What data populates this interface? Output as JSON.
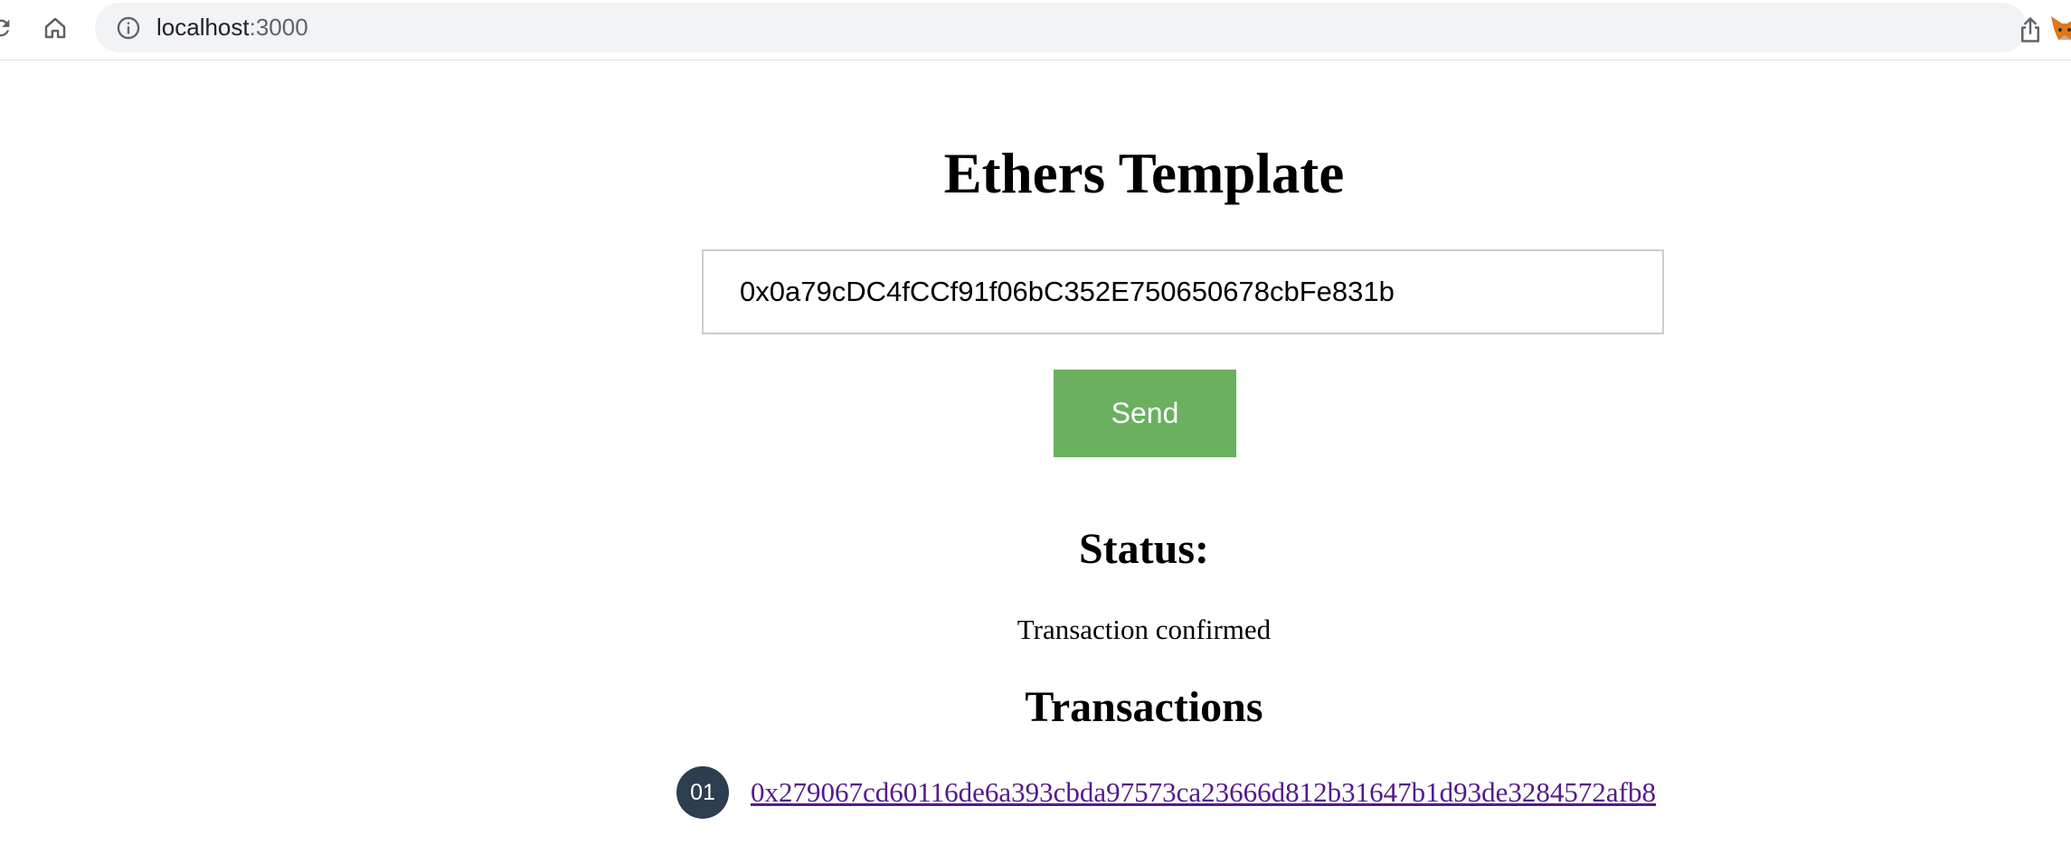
{
  "browser": {
    "url_host": "localhost",
    "url_port": ":3000",
    "icons": [
      "reload-icon",
      "home-icon",
      "info-icon",
      "share-icon",
      "star-icon",
      "extension-fox-icon"
    ]
  },
  "page": {
    "title": "Ethers Template",
    "address_input_value": "0x0a79cDC4fCCf91f06bC352E750650678cbFe831b",
    "send_label": "Send",
    "status_heading": "Status:",
    "status_text": "Transaction confirmed",
    "transactions_heading": "Transactions",
    "transactions": [
      {
        "index": "01",
        "hash": "0x279067cd60116de6a393cbda97573ca23666d812b31647b1d93de3284572afb8"
      }
    ]
  },
  "colors": {
    "send_button": "#6ab05f",
    "badge": "#2c3e50",
    "visited_link": "#551a8b",
    "omnibox": "#f1f3f4"
  }
}
